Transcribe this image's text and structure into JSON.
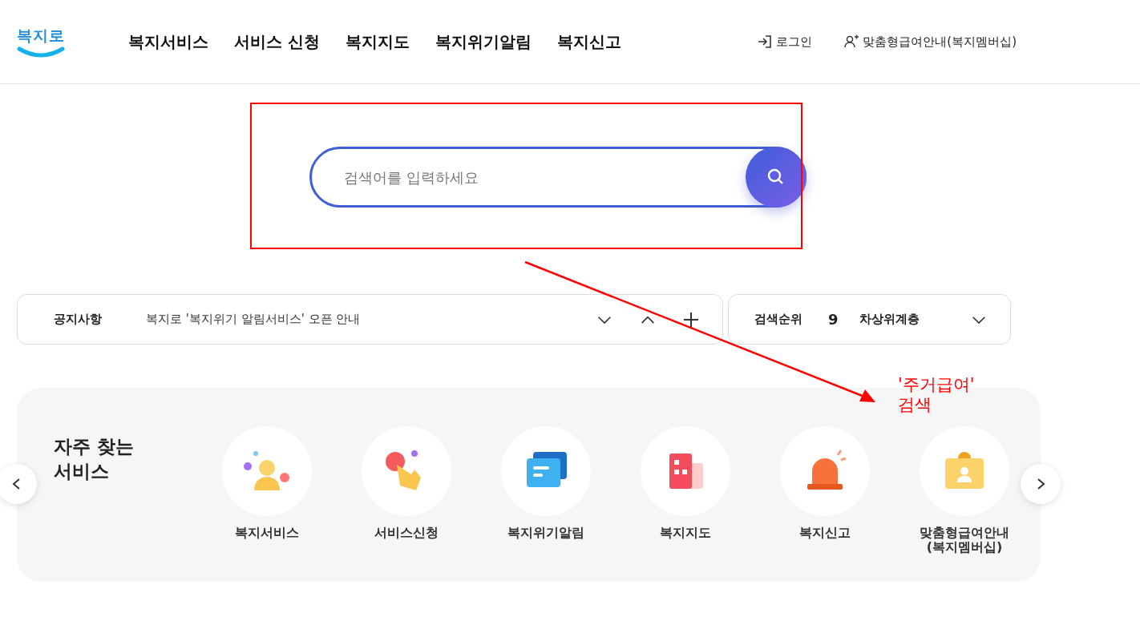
{
  "header": {
    "logo": "복지로",
    "nav": [
      {
        "label": "복지서비스"
      },
      {
        "label": "서비스 신청"
      },
      {
        "label": "복지지도"
      },
      {
        "label": "복지위기알림"
      },
      {
        "label": "복지신고"
      }
    ],
    "links": [
      {
        "kind": "login",
        "label": "로그인"
      },
      {
        "kind": "member",
        "label": "맞춤형급여안내(복지멤버십)"
      }
    ]
  },
  "search": {
    "placeholder": "검색어를 입력하세요"
  },
  "notice": {
    "label": "공지사항",
    "text": "복지로 '복지위기 알림서비스' 오픈 안내"
  },
  "ranking": {
    "label": "검색순위",
    "rank": "9",
    "term": "차상위계층"
  },
  "services": {
    "title": "자주 찾는\n서비스",
    "items": [
      {
        "label": "복지서비스"
      },
      {
        "label": "서비스신청"
      },
      {
        "label": "복지위기알림"
      },
      {
        "label": "복지지도"
      },
      {
        "label": "복지신고"
      },
      {
        "label": "맞춤형급여안내\n(복지멤버십)"
      }
    ]
  },
  "annotation": {
    "text": "'주거급여'\n검색",
    "color": "#ff0000"
  }
}
